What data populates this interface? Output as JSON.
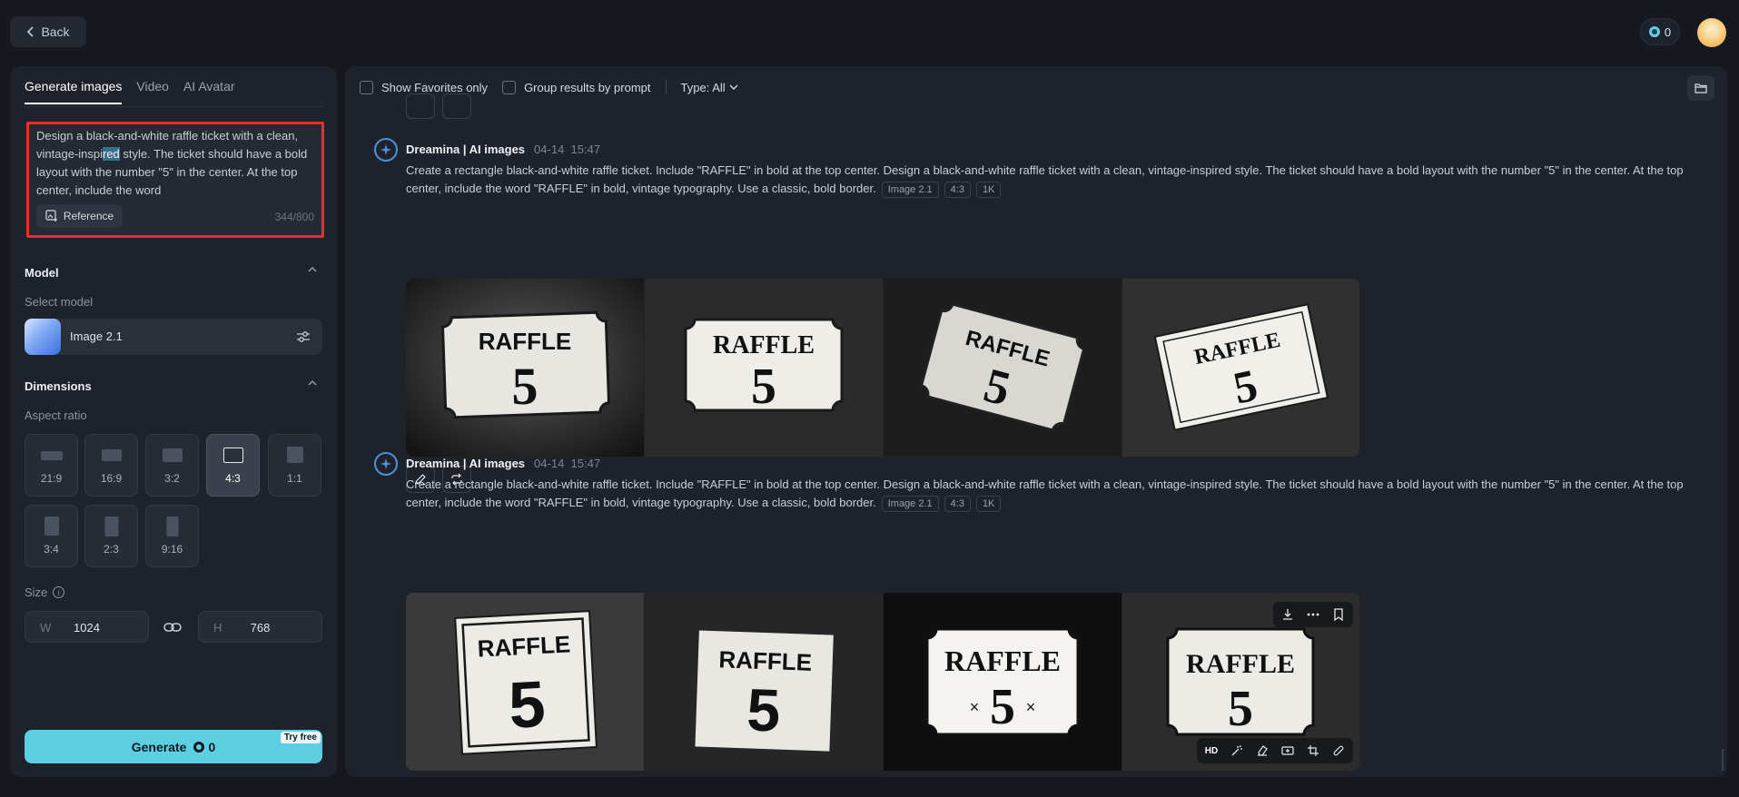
{
  "header": {
    "back_label": "Back",
    "credits": "0"
  },
  "sidebar": {
    "tabs": [
      "Generate images",
      "Video",
      "AI Avatar"
    ],
    "prompt": {
      "text_before": "Design a black-and-white raffle ticket with a clean, vintage-inspi",
      "text_highlight": "red",
      "text_after": " style. The ticket should have a bold layout with the number \"5\" in the center. At the top center, include the word",
      "reference_label": "Reference",
      "char_count": "344/800"
    },
    "model": {
      "title": "Model",
      "select_label": "Select model",
      "selected": "Image 2.1"
    },
    "dimensions": {
      "title": "Dimensions",
      "aspect_label": "Aspect ratio",
      "ratios": [
        "21:9",
        "16:9",
        "3:2",
        "4:3",
        "1:1",
        "3:4",
        "2:3",
        "9:16"
      ],
      "selected_ratio": "4:3",
      "size_label": "Size",
      "width_prefix": "W",
      "width": "1024",
      "height_prefix": "H",
      "height": "768"
    },
    "generate": {
      "label": "Generate",
      "cost": "0",
      "badge": "Try free"
    }
  },
  "main": {
    "filters": {
      "favorites_label": "Show Favorites only",
      "group_label": "Group results by prompt",
      "type_label": "Type: All"
    },
    "groups": [
      {
        "source": "Dreamina | AI images",
        "date": "04-14",
        "time": "15:47",
        "prompt": "Create a rectangle black-and-white raffle ticket. Include \"RAFFLE\" in bold at the top center. Design a black-and-white raffle ticket with a clean, vintage-inspired style. The ticket should have a bold layout with the number \"5\" in the center. At the top center, include the word \"RAFFLE\" in bold, vintage typography. Use a classic, bold border.",
        "tags": [
          "Image 2.1",
          "4:3",
          "1K"
        ],
        "images": [
          {
            "word": "RAFFLE",
            "num": "5"
          },
          {
            "word": "RAFFLE",
            "num": "5"
          },
          {
            "word": "RAFFLE",
            "num": "5"
          },
          {
            "word": "RAFFLE",
            "num": "5"
          }
        ]
      },
      {
        "source": "Dreamina | AI images",
        "date": "04-14",
        "time": "15:47",
        "prompt": "Create a rectangle black-and-white raffle ticket. Include \"RAFFLE\" in bold at the top center. Design a black-and-white raffle ticket with a clean, vintage-inspired style. The ticket should have a bold layout with the number \"5\" in the center. At the top center, include the word \"RAFFLE\" in bold, vintage typography. Use a classic, bold border.",
        "tags": [
          "Image 2.1",
          "4:3",
          "1K"
        ],
        "images": [
          {
            "word": "RAFFLE",
            "num": "5"
          },
          {
            "word": "RAFFLE",
            "num": "5"
          },
          {
            "word": "RAFFLE",
            "num": "5"
          },
          {
            "word": "RAFFLE",
            "num": "5"
          }
        ],
        "hover_overlay": {
          "hd_label": "HD"
        }
      }
    ]
  },
  "colors": {
    "accent": "#5ccfe2",
    "highlight_border": "#e23325",
    "panel": "#1e232b",
    "background": "#15181e"
  }
}
